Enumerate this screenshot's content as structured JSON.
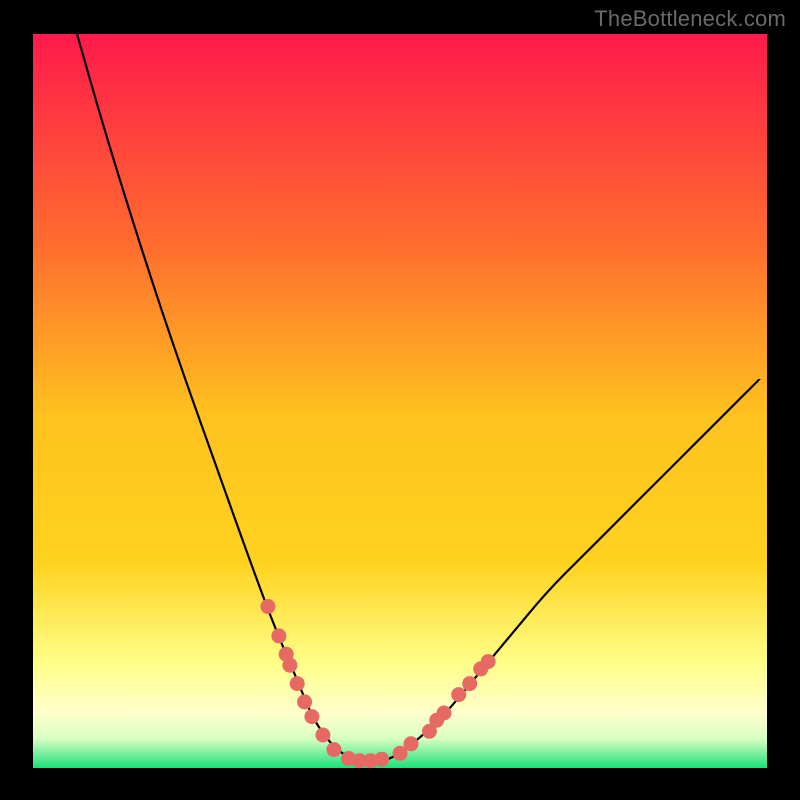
{
  "watermark": "TheBottleneck.com",
  "colors": {
    "background_black": "#000000",
    "gradient_top": "#ff1a4b",
    "gradient_mid_upper": "#ff7a2a",
    "gradient_mid": "#ffd21f",
    "gradient_lower": "#ffff66",
    "gradient_band_pale": "#ffffcc",
    "gradient_bottom_green": "#1be07a",
    "curve_color": "#000000",
    "marker_fill": "#e66a63",
    "marker_stroke": "#c94f49"
  },
  "chart_data": {
    "type": "line",
    "title": "",
    "xlabel": "",
    "ylabel": "",
    "xlim": [
      0,
      100
    ],
    "ylim": [
      0,
      100
    ],
    "series": [
      {
        "name": "bottleneck-curve",
        "x": [
          6,
          10,
          15,
          20,
          25,
          30,
          33,
          36,
          38,
          40,
          42,
          44,
          46,
          48,
          50,
          55,
          60,
          65,
          70,
          75,
          80,
          85,
          90,
          95,
          99
        ],
        "y": [
          100,
          86,
          70,
          55,
          41,
          27,
          19,
          12,
          7,
          4,
          2,
          1,
          1,
          1,
          2,
          6,
          12,
          18,
          24,
          29,
          34,
          39,
          44,
          49,
          53
        ]
      }
    ],
    "markers": [
      {
        "x": 32,
        "y": 22
      },
      {
        "x": 33.5,
        "y": 18
      },
      {
        "x": 34.5,
        "y": 15.5
      },
      {
        "x": 35,
        "y": 14
      },
      {
        "x": 36,
        "y": 11.5
      },
      {
        "x": 37,
        "y": 9
      },
      {
        "x": 38,
        "y": 7
      },
      {
        "x": 39.5,
        "y": 4.5
      },
      {
        "x": 41,
        "y": 2.5
      },
      {
        "x": 43,
        "y": 1.3
      },
      {
        "x": 44.5,
        "y": 1
      },
      {
        "x": 46,
        "y": 1
      },
      {
        "x": 47.5,
        "y": 1.2
      },
      {
        "x": 50,
        "y": 2
      },
      {
        "x": 51.5,
        "y": 3.3
      },
      {
        "x": 54,
        "y": 5
      },
      {
        "x": 55,
        "y": 6.5
      },
      {
        "x": 56,
        "y": 7.5
      },
      {
        "x": 58,
        "y": 10
      },
      {
        "x": 59.5,
        "y": 11.5
      },
      {
        "x": 61,
        "y": 13.5
      },
      {
        "x": 62,
        "y": 14.5
      }
    ]
  }
}
